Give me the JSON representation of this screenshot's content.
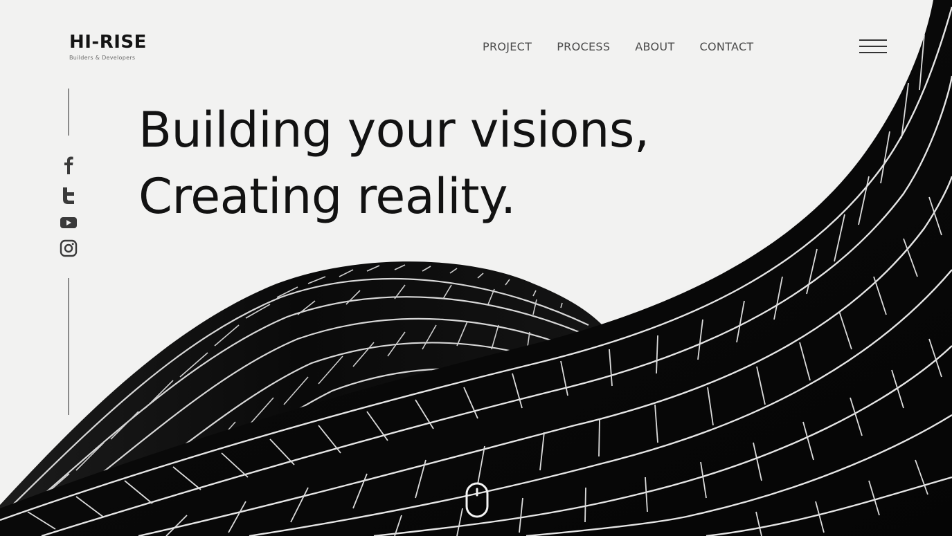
{
  "brand": {
    "name": "HI-RISE",
    "tagline": "Builders & Developers"
  },
  "nav": {
    "items": [
      {
        "label": "PROJECT"
      },
      {
        "label": "PROCESS"
      },
      {
        "label": "ABOUT"
      },
      {
        "label": "CONTACT"
      }
    ],
    "menu_icon": "hamburger-menu-icon"
  },
  "social": {
    "icons": [
      "facebook-icon",
      "twitter-icon",
      "youtube-icon",
      "instagram-icon"
    ]
  },
  "hero": {
    "line1": "Building your visions,",
    "line2": "Creating reality."
  },
  "scroll": {
    "icon": "mouse-scroll-icon"
  },
  "colors": {
    "background": "#f2f2f1",
    "text": "#121212",
    "building": "#0a0a0a",
    "building_lines": "#e6e6e6"
  }
}
